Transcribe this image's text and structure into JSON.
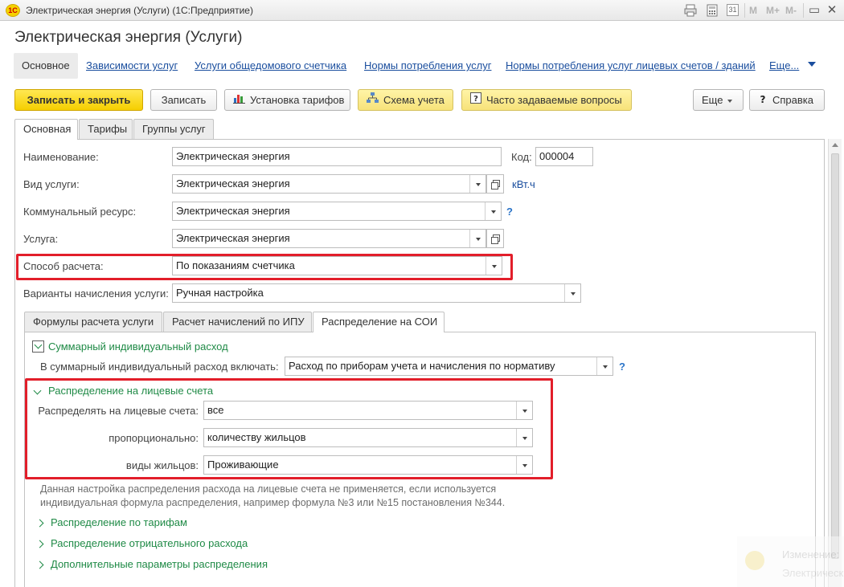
{
  "window": {
    "title": "Электрическая энергия (Услуги)  (1С:Предприятие)",
    "logo": "1С",
    "icons": [
      "print-icon",
      "calculator-icon",
      "calendar-icon"
    ],
    "calendar_day": "31",
    "mem": [
      "M",
      "M+",
      "M-"
    ],
    "controls": [
      "restore-icon",
      "close-icon"
    ]
  },
  "form": {
    "title": "Электрическая энергия (Услуги)"
  },
  "nav": {
    "items": [
      "Основное",
      "Зависимости услуг",
      "Услуги общедомового счетчика",
      "Нормы потребления услуг",
      "Нормы потребления услуг лицевых счетов / зданий",
      "Еще..."
    ]
  },
  "toolbar": {
    "save_close": "Записать и закрыть",
    "save": "Записать",
    "tariffs": "Установка тарифов",
    "scheme": "Схема учета",
    "faq": "Часто задаваемые вопросы",
    "more": "Еще",
    "help": "Справка"
  },
  "tabs": [
    "Основная",
    "Тарифы",
    "Группы услуг"
  ],
  "fields": {
    "name_label": "Наименование:",
    "name_value": "Электрическая энергия",
    "code_label": "Код:",
    "code_value": "000004",
    "service_type_label": "Вид услуги:",
    "service_type_value": "Электрическая энергия",
    "unit": "кВт.ч",
    "resource_label": "Коммунальный ресурс:",
    "resource_value": "Электрическая энергия",
    "service_label": "Услуга:",
    "service_value": "Электрическая энергия",
    "calc_method_label": "Способ расчета:",
    "calc_method_value": "По показаниям счетчика",
    "accrual_label": "Варианты начисления услуги:",
    "accrual_value": "Ручная настройка",
    "help_mark": "?"
  },
  "inner_tabs": [
    "Формулы расчета услуги",
    "Расчет начислений по ИПУ",
    "Распределение на СОИ"
  ],
  "soi": {
    "group1_title": "Суммарный индивидуальный расход",
    "include_label": "В суммарный индивидуальный расход включать:",
    "include_value": "Расход по приборам учета и начисления по нормативу",
    "group2_title": "Распределение на лицевые счета",
    "distribute_label": "Распределять на лицевые счета:",
    "distribute_value": "все",
    "proportional_label": "пропорционально:",
    "proportional_value": "количеству жильцов",
    "residents_label": "виды жильцов:",
    "residents_value": "Проживающие",
    "note_line1": "Данная настройка распределения расхода на лицевые счета не применяется, если используется",
    "note_line2": "индивидуальная формула распределения, например формула №3 или №15 постановления №344.",
    "group3_title": "Распределение по тарифам",
    "group4_title": "Распределение отрицательного расхода",
    "group5_title": "Дополнительные параметры распределения"
  },
  "notification": {
    "line1": "Изменение:",
    "line2": "Электрическ..."
  },
  "colors": {
    "primary_button": "#f5cf00",
    "link": "#1a4e9e",
    "group_header": "#1f8a46",
    "highlight": "#e21e2a"
  }
}
